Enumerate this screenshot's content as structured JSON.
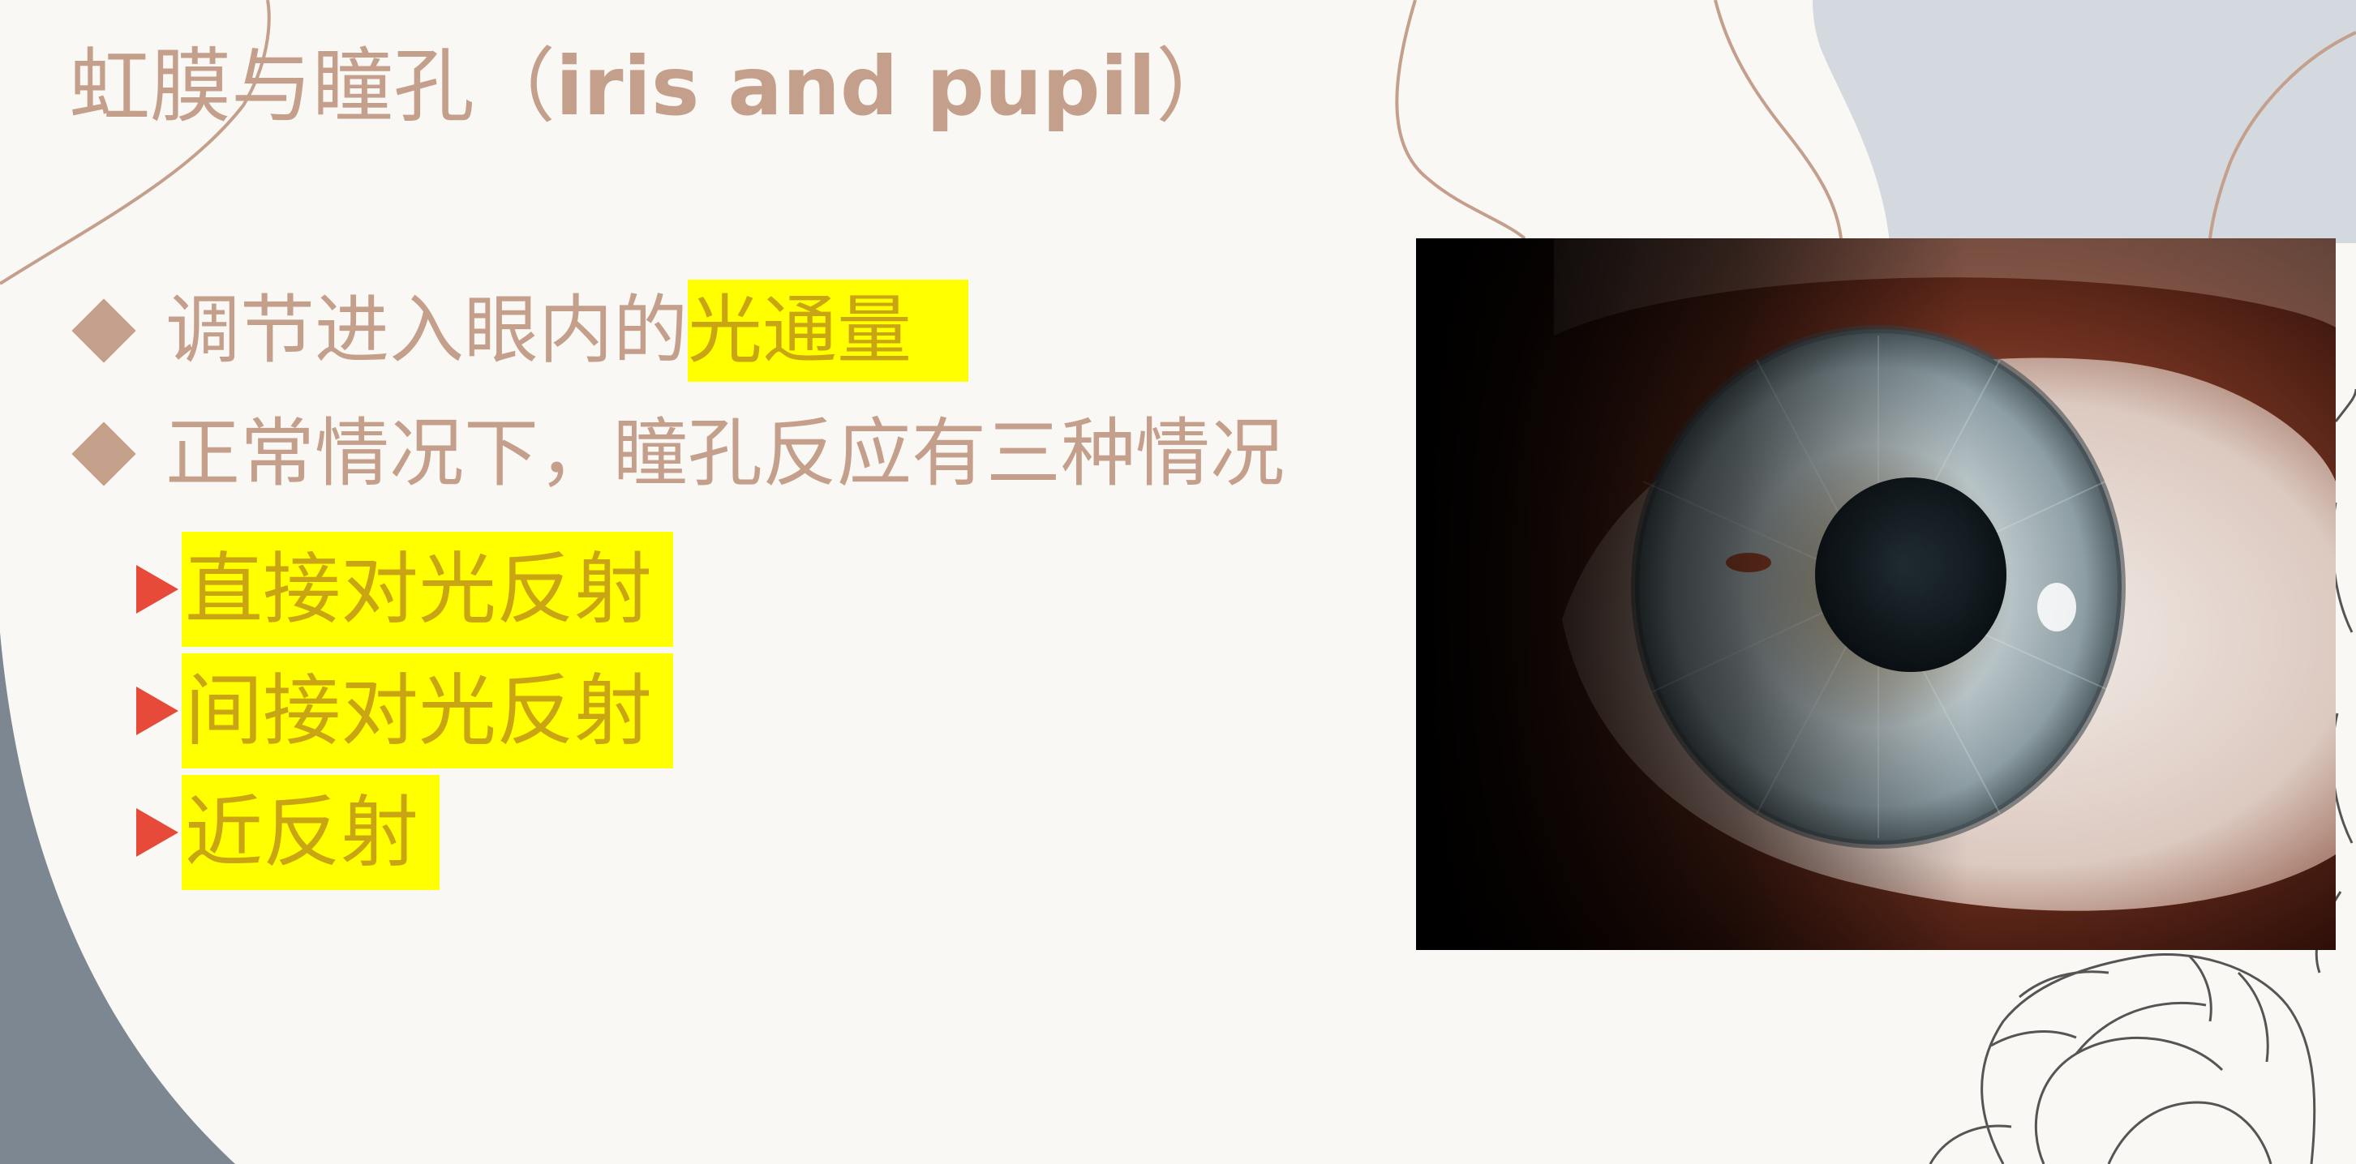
{
  "slide": {
    "title_cn": "虹膜与瞳孔（",
    "title_en": "iris and pupil",
    "title_close": "）"
  },
  "bullets": [
    {
      "text": "调节进入眼内的",
      "highlight": "光通量"
    },
    {
      "text": "正常情况下，瞳孔反应有三种情况"
    }
  ],
  "sub_bullets": [
    {
      "text": "直接对光反射"
    },
    {
      "text": "间接对光反射"
    },
    {
      "text": "近反射"
    }
  ],
  "image": {
    "subject": "eye-iris-pupil-photo"
  },
  "colors": {
    "background": "#faf8f4",
    "text": "#c4a08c",
    "highlight_bg": "#ffff00",
    "highlight_text": "#c9a514",
    "arrow": "#e84a3a",
    "grey_shape": "#7d8791",
    "blue_shape": "#d3d9df"
  }
}
